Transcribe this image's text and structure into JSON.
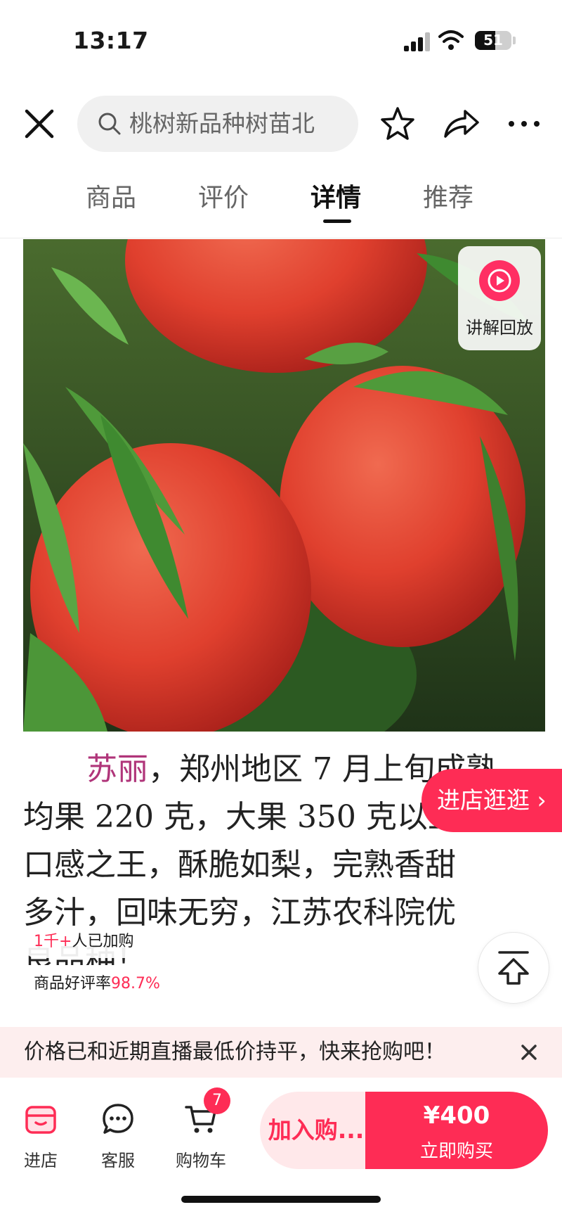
{
  "status_bar": {
    "time": "13:17",
    "battery": "51"
  },
  "header": {
    "search_text": "桃树新品种树苗北",
    "tabs": [
      "商品",
      "评价",
      "详情",
      "推荐"
    ],
    "active_tab": "详情"
  },
  "content": {
    "replay_label": "讲解回放",
    "desc_lines": [
      [
        "苏丽",
        "，郑州地区 7 月上旬成熟，"
      ],
      [
        "",
        "均果 220 克，大果 350 克以上，"
      ],
      [
        "",
        "口感之王，酥脆如梨，完熟香甜"
      ],
      [
        "",
        "多汁，回味无穷，江苏农科院优"
      ],
      [
        "",
        "良品种！"
      ]
    ],
    "store_visit": "进店逛逛 ›",
    "buyers_count": "1千+",
    "buyers_text": "人已加购",
    "rating_label": "商品好评率",
    "rating_value": "98.7%"
  },
  "price_banner": {
    "text": "价格已和近期直播最低价持平，快来抢购吧！"
  },
  "bottom_bar": {
    "store": "进店",
    "service": "客服",
    "cart": "购物车",
    "cart_count": "7",
    "add_to_cart": "加入购...",
    "price": "¥400",
    "buy_now": "立即购买"
  },
  "colors": {
    "accent": "#fe2c55",
    "banner_bg": "#fdeeee"
  },
  "icons": [
    "close-icon",
    "search-icon",
    "star-icon",
    "share-icon",
    "more-icon",
    "play-icon",
    "arrow-up-icon",
    "store-icon",
    "chat-icon",
    "cart-icon"
  ]
}
